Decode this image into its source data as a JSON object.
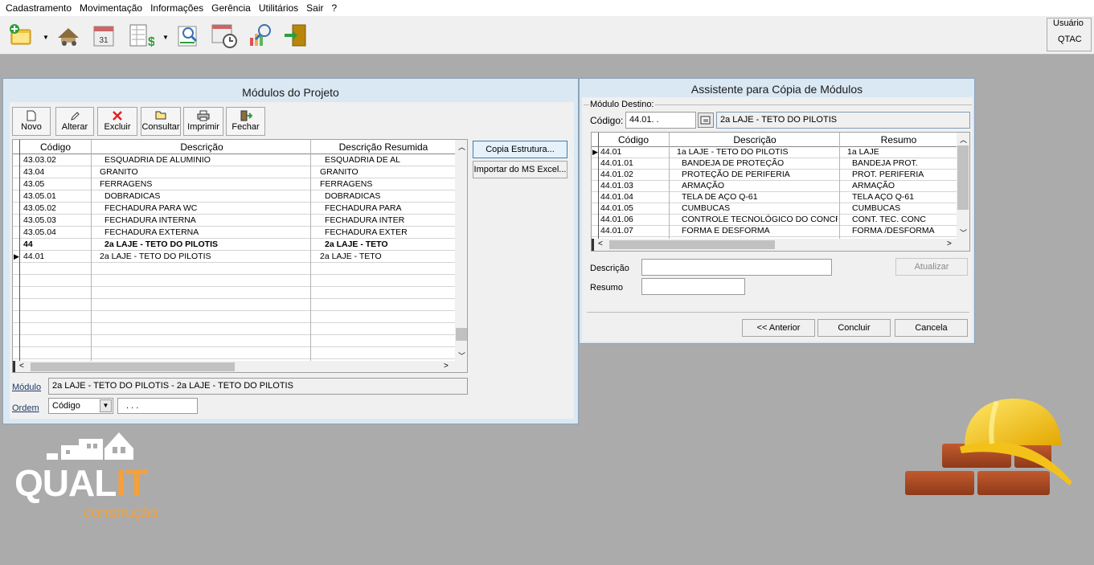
{
  "menu": [
    "Cadastramento",
    "Movimentação",
    "Informações",
    "Gerência",
    "Utilitários",
    "Sair",
    "?"
  ],
  "toolbar_icons": [
    "new-project-icon",
    "construction-icon",
    "calendar-icon",
    "spreadsheet-money-icon",
    "search-report-icon",
    "schedule-clock-icon",
    "chart-search-icon",
    "exit-door-icon"
  ],
  "user": {
    "label": "Usuário",
    "value": "QTAC"
  },
  "modulos": {
    "title": "Módulos do Projeto",
    "buttons": {
      "novo": "Novo",
      "alterar": "Alterar",
      "excluir": "Excluir",
      "consultar": "Consultar",
      "imprimir": "Imprimir",
      "fechar": "Fechar"
    },
    "columns": [
      "Código",
      "Descrição",
      "Descrição Resumida"
    ],
    "rows": [
      {
        "codigo": "43.03.02",
        "descricao": "ESQUADRIA DE ALUMINIO",
        "resumo": "ESQUADRIA DE AL",
        "level": 3
      },
      {
        "codigo": "43.04",
        "descricao": "GRANITO",
        "resumo": "GRANITO",
        "level": 2
      },
      {
        "codigo": "43.05",
        "descricao": "FERRAGENS",
        "resumo": "FERRAGENS",
        "level": 2
      },
      {
        "codigo": "43.05.01",
        "descricao": "DOBRADICAS",
        "resumo": "DOBRADICAS",
        "level": 3
      },
      {
        "codigo": "43.05.02",
        "descricao": "FECHADURA PARA WC",
        "resumo": "FECHADURA PARA",
        "level": 3
      },
      {
        "codigo": "43.05.03",
        "descricao": "FECHADURA INTERNA",
        "resumo": "FECHADURA INTER",
        "level": 3
      },
      {
        "codigo": "43.05.04",
        "descricao": "FECHADURA EXTERNA",
        "resumo": "FECHADURA EXTER",
        "level": 3
      },
      {
        "codigo": "44",
        "descricao": "2a LAJE - TETO DO PILOTIS",
        "resumo": "2a LAJE - TETO",
        "level": 1
      },
      {
        "codigo": "44.01",
        "descricao": "2a LAJE - TETO DO PILOTIS",
        "resumo": "2a LAJE - TETO",
        "level": 2
      }
    ],
    "copia_button": "Copia Estrutura...",
    "importar_button": "Importar do MS Excel...",
    "modulo_label": "Módulo",
    "modulo_value": "2a LAJE - TETO DO PILOTIS - 2a LAJE - TETO DO PILOTIS",
    "ordem_label": "Ordem",
    "ordem_value": "Código",
    "ordem_mask": ". . ."
  },
  "assistente": {
    "title": "Assistente para Cópia de Módulos",
    "group_label": "Módulo Destino:",
    "codigo_label": "Código:",
    "codigo_value": "44.01. .",
    "codigo_desc": "2a LAJE - TETO DO PILOTIS",
    "columns": [
      "Código",
      "Descrição",
      "Resumo"
    ],
    "rows": [
      {
        "codigo": "44.01",
        "descricao": "1a LAJE - TETO DO PILOTIS",
        "resumo": "1a LAJE"
      },
      {
        "codigo": "44.01.01",
        "descricao": "BANDEJA DE PROTEÇÃO",
        "resumo": "BANDEJA PROT."
      },
      {
        "codigo": "44.01.02",
        "descricao": "PROTEÇÃO DE PERIFERIA",
        "resumo": "PROT. PERIFERIA"
      },
      {
        "codigo": "44.01.03",
        "descricao": "ARMAÇÃO",
        "resumo": "ARMAÇÃO"
      },
      {
        "codigo": "44.01.04",
        "descricao": "TELA DE AÇO Q-61",
        "resumo": "TELA AÇO Q-61"
      },
      {
        "codigo": "44.01.05",
        "descricao": "CUMBUCAS",
        "resumo": "CUMBUCAS"
      },
      {
        "codigo": "44.01.06",
        "descricao": "CONTROLE TECNOLÓGICO DO CONCRE",
        "resumo": "CONT. TEC. CONC"
      },
      {
        "codigo": "44.01.07",
        "descricao": "FORMA E DESFORMA",
        "resumo": "FORMA /DESFORMA"
      }
    ],
    "descricao_label": "Descrição",
    "resumo_label": "Resumo",
    "atualizar": "Atualizar",
    "anterior": "<< Anterior",
    "concluir": "Concluir",
    "cancela": "Cancela"
  },
  "logo": {
    "brand_a": "QUAL",
    "brand_b": "IT",
    "sub": "construção"
  },
  "colors": {
    "accent_orange": "#f5a03a",
    "window_title": "#dae8f4"
  }
}
